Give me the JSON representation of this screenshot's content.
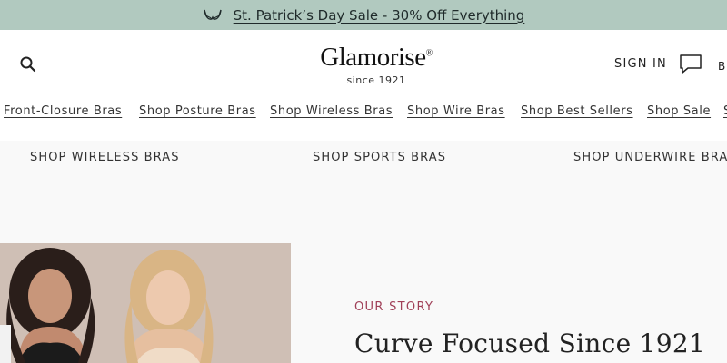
{
  "promo": {
    "text": "St. Patrick’s Day Sale - 30% Off Everything",
    "icon": "bra-icon",
    "background": "#b1c9bf"
  },
  "header": {
    "logo": {
      "wordmark": "Glamorise",
      "registered": "®",
      "tagline": "since 1921"
    },
    "signin_label": "SIGN IN",
    "bag_label": "B",
    "search_icon": "search-icon",
    "chat_icon": "chat-icon"
  },
  "nav": {
    "items": [
      {
        "label": "Front-Closure Bras"
      },
      {
        "label": "Shop Posture Bras"
      },
      {
        "label": "Shop Wireless Bras"
      },
      {
        "label": "Shop Wire Bras"
      },
      {
        "label": "Shop Best Sellers"
      },
      {
        "label": "Shop Sale"
      },
      {
        "label": "S"
      }
    ]
  },
  "categories": [
    {
      "label": "SHOP WIRELESS BRAS"
    },
    {
      "label": "SHOP SPORTS BRAS"
    },
    {
      "label": "SHOP UNDERWIRE BRAS"
    }
  ],
  "story": {
    "eyebrow": "OUR STORY",
    "heading": "Curve Focused Since 1921",
    "accent_color": "#a04058"
  }
}
